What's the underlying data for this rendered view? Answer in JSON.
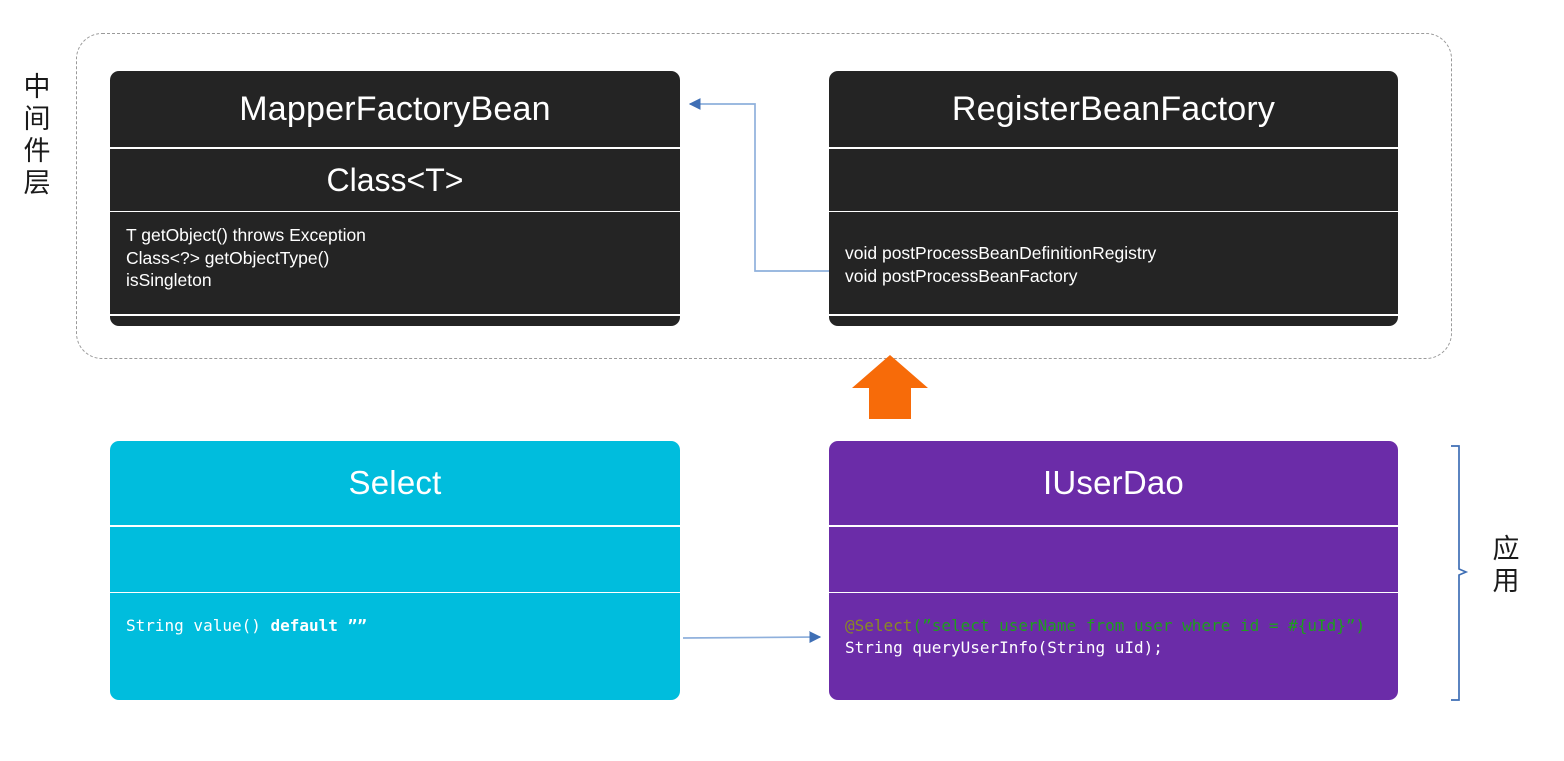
{
  "layers": {
    "middleware_label": "中间件层",
    "middleware_label_chars": [
      "中",
      "间",
      "件",
      "层"
    ],
    "application_label": "应用",
    "application_label_chars": [
      "应",
      "用"
    ]
  },
  "colors": {
    "dark_box": "#242424",
    "cyan_box": "#00bddd",
    "purple_box": "#6b2ca8",
    "arrow_orange": "#f76b09",
    "connector_blue": "#4a7ebb",
    "dashed_border": "#9a9a9a",
    "annotation_token": "#8a8a22",
    "string_token": "#1e9e1e"
  },
  "boxes": {
    "mapper_factory_bean": {
      "title": "MapperFactoryBean",
      "subtitle": "Class<T>",
      "members": [
        "T getObject() throws Exception",
        "Class<?> getObjectType()",
        "isSingleton"
      ]
    },
    "register_bean_factory": {
      "title": "RegisterBeanFactory",
      "subtitle": "",
      "members": [
        "void postProcessBeanDefinitionRegistry",
        "void postProcessBeanFactory"
      ]
    },
    "select_annotation": {
      "title": "Select",
      "subtitle": "",
      "member_prefix": "String value() ",
      "member_keyword": "default",
      "member_suffix": " ””"
    },
    "iuser_dao": {
      "title": "IUserDao",
      "subtitle": "",
      "code_annotation": "@Select",
      "code_string": "(”select userName from user where id = #{uId}”)",
      "code_method": "String queryUserInfo(String uId);"
    }
  },
  "connectors": {
    "register_to_mapper": "elbow-arrow-left",
    "select_to_iuserdao": "straight-arrow-right",
    "app_to_middleware": "orange-up-arrow",
    "application_bracket": "right-curly-bracket"
  }
}
